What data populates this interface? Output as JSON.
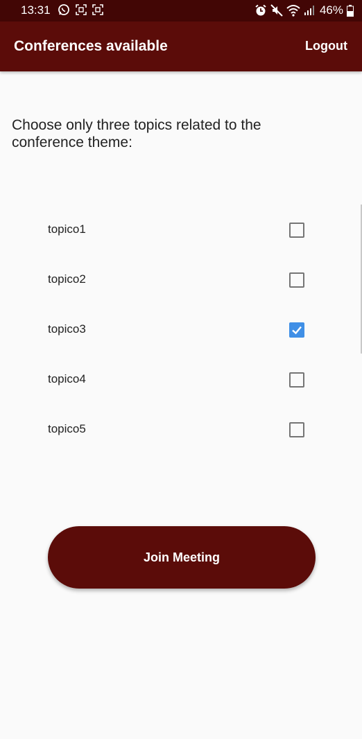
{
  "status_bar": {
    "time": "13:31",
    "battery_percent": "46%",
    "left_icons": [
      "whatsapp-icon",
      "screenshot-icon",
      "screenshot-icon"
    ],
    "right_icons": [
      "alarm-icon",
      "mute-icon",
      "wifi-icon",
      "signal-icon",
      "battery-icon"
    ]
  },
  "app_bar": {
    "title": "Conferences available",
    "logout_label": "Logout"
  },
  "instruction": "Choose only three topics related to the conference theme:",
  "topics": [
    {
      "label": "topico1",
      "checked": false
    },
    {
      "label": "topico2",
      "checked": false
    },
    {
      "label": "topico3",
      "checked": true
    },
    {
      "label": "topico4",
      "checked": false
    },
    {
      "label": "topico5",
      "checked": false
    }
  ],
  "join_button": {
    "label": "Join Meeting"
  },
  "colors": {
    "primary": "#5b0c09",
    "status_bar": "#420605",
    "checkbox_checked": "#3f8fe6",
    "background": "#fafafa"
  }
}
